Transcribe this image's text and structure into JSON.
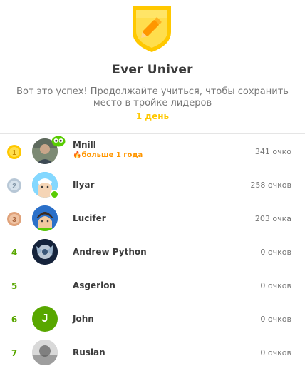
{
  "league": {
    "title": "Ever Univer",
    "subtitle": "Вот это успех! Продолжайте учиться, чтобы сохранить место в тройке лидеров",
    "days_left": "1 день"
  },
  "leaderboard": [
    {
      "rank": "1",
      "name": "Mnill",
      "streak": "больше 1 года",
      "xp": "341 очко",
      "medal_color": "#ffc800",
      "online": false,
      "has_badge": true
    },
    {
      "rank": "2",
      "name": "Ilyar",
      "streak": "",
      "xp": "258 очков",
      "medal_color": "#b7c7d6",
      "online": true,
      "has_badge": false
    },
    {
      "rank": "3",
      "name": "Lucifer",
      "streak": "",
      "xp": "203 очка",
      "medal_color": "#e0a27a",
      "online": false,
      "has_badge": false
    },
    {
      "rank": "4",
      "name": "Andrew Python",
      "streak": "",
      "xp": "0 очков"
    },
    {
      "rank": "5",
      "name": "Asgerion",
      "streak": "",
      "xp": "0 очков"
    },
    {
      "rank": "6",
      "name": "John",
      "avatar_letter": "J",
      "streak": "",
      "xp": "0 очков"
    },
    {
      "rank": "7",
      "name": "Ruslan",
      "streak": "",
      "xp": "0 очков"
    }
  ],
  "colors": {
    "accent_green": "#58a700",
    "gold": "#ffc800",
    "streak_orange": "#ff9600"
  }
}
